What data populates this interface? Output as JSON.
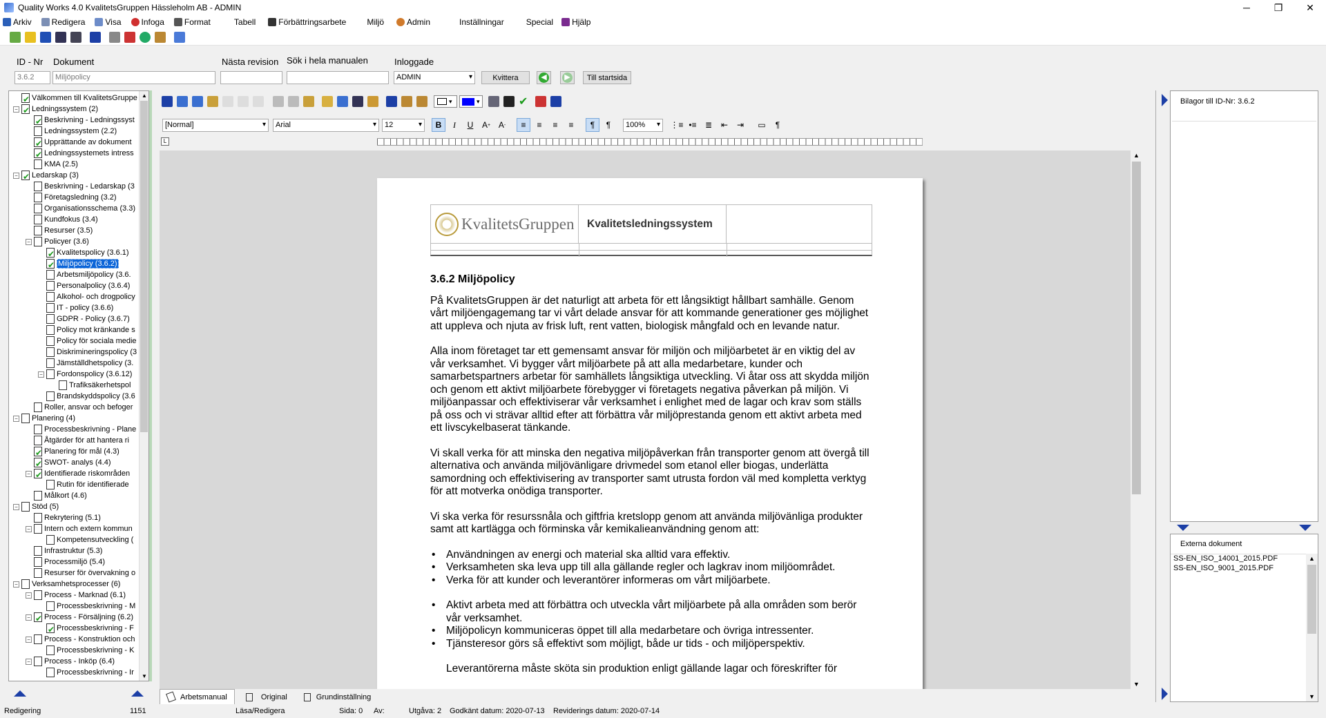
{
  "window": {
    "title": "Quality Works 4.0 KvalitetsGruppen Hässleholm AB - ADMIN"
  },
  "menu": [
    "Arkiv",
    "Redigera",
    "Visa",
    "Infoga",
    "Format",
    "Tabell",
    "Förbättringsarbete",
    "Miljö",
    "Admin",
    "Inställningar",
    "Special",
    "Hjälp"
  ],
  "header": {
    "id_label": "ID - Nr",
    "id_value": "3.6.2",
    "doc_label": "Dokument",
    "doc_value": "Miljöpolicy",
    "next_rev_label": "Nästa revision",
    "next_rev_value": "",
    "search_label": "Sök i hela manualen",
    "search_value": "",
    "logged_label": "Inloggade",
    "logged_value": "ADMIN",
    "kvittera": "Kvittera",
    "startpage": "Till startsida"
  },
  "tree": [
    {
      "label": "Välkommen till KvalitetsGruppe",
      "level": 1,
      "exp": "",
      "chk": true
    },
    {
      "label": "Ledningssystem (2)",
      "level": 1,
      "exp": "−",
      "chk": true
    },
    {
      "label": "Beskrivning - Ledningssyst",
      "level": 2,
      "exp": "",
      "chk": true
    },
    {
      "label": "Ledningssystem (2.2)",
      "level": 2,
      "exp": "",
      "chk": false
    },
    {
      "label": "Upprättande av dokument",
      "level": 2,
      "exp": "",
      "chk": true
    },
    {
      "label": "Ledningssystemets intress",
      "level": 2,
      "exp": "",
      "chk": true
    },
    {
      "label": "KMA (2.5)",
      "level": 2,
      "exp": "",
      "chk": false
    },
    {
      "label": "Ledarskap (3)",
      "level": 1,
      "exp": "−",
      "chk": true
    },
    {
      "label": "Beskrivning - Ledarskap (3",
      "level": 2,
      "exp": "",
      "chk": false
    },
    {
      "label": "Företagsledning (3.2)",
      "level": 2,
      "exp": "",
      "chk": false
    },
    {
      "label": "Organisationsschema (3.3)",
      "level": 2,
      "exp": "",
      "chk": false
    },
    {
      "label": "Kundfokus (3.4)",
      "level": 2,
      "exp": "",
      "chk": false
    },
    {
      "label": "Resurser (3.5)",
      "level": 2,
      "exp": "",
      "chk": false
    },
    {
      "label": "Policyer (3.6)",
      "level": 2,
      "exp": "−",
      "chk": false
    },
    {
      "label": "Kvalitetspolicy (3.6.1)",
      "level": 3,
      "exp": "",
      "chk": true
    },
    {
      "label": "Miljöpolicy (3.6.2)",
      "level": 3,
      "exp": "",
      "chk": true,
      "sel": true
    },
    {
      "label": "Arbetsmiljöpolicy (3.6.",
      "level": 3,
      "exp": "",
      "chk": false
    },
    {
      "label": "Personalpolicy (3.6.4)",
      "level": 3,
      "exp": "",
      "chk": false
    },
    {
      "label": "Alkohol- och drogpolicy",
      "level": 3,
      "exp": "",
      "chk": false
    },
    {
      "label": "IT - policy (3.6.6)",
      "level": 3,
      "exp": "",
      "chk": false
    },
    {
      "label": "GDPR - Policy (3.6.7)",
      "level": 3,
      "exp": "",
      "chk": false
    },
    {
      "label": "Policy mot kränkande s",
      "level": 3,
      "exp": "",
      "chk": false
    },
    {
      "label": "Policy för sociala medie",
      "level": 3,
      "exp": "",
      "chk": false
    },
    {
      "label": "Diskrimineringspolicy (3",
      "level": 3,
      "exp": "",
      "chk": false
    },
    {
      "label": "Jämställdhetspolicy (3.",
      "level": 3,
      "exp": "",
      "chk": false
    },
    {
      "label": "Fordonspolicy (3.6.12)",
      "level": 3,
      "exp": "−",
      "chk": false
    },
    {
      "label": "Trafiksäkerhetspol",
      "level": 4,
      "exp": "",
      "chk": false
    },
    {
      "label": "Brandskyddspolicy (3.6",
      "level": 3,
      "exp": "",
      "chk": false
    },
    {
      "label": "Roller, ansvar och befoger",
      "level": 2,
      "exp": "",
      "chk": false
    },
    {
      "label": "Planering (4)",
      "level": 1,
      "exp": "−",
      "chk": false
    },
    {
      "label": "Processbeskrivning - Plane",
      "level": 2,
      "exp": "",
      "chk": false
    },
    {
      "label": "Åtgärder för att hantera ri",
      "level": 2,
      "exp": "",
      "chk": false
    },
    {
      "label": "Planering för mål (4.3)",
      "level": 2,
      "exp": "",
      "chk": true
    },
    {
      "label": "SWOT- analys (4.4)",
      "level": 2,
      "exp": "",
      "chk": true
    },
    {
      "label": "Identifierade riskområden",
      "level": 2,
      "exp": "−",
      "chk": true
    },
    {
      "label": "Rutin för identifierade",
      "level": 3,
      "exp": "",
      "chk": false
    },
    {
      "label": "Målkort (4.6)",
      "level": 2,
      "exp": "",
      "chk": false
    },
    {
      "label": "Stöd (5)",
      "level": 1,
      "exp": "−",
      "chk": false
    },
    {
      "label": "Rekrytering (5.1)",
      "level": 2,
      "exp": "",
      "chk": false
    },
    {
      "label": "Intern och extern kommun",
      "level": 2,
      "exp": "−",
      "chk": false
    },
    {
      "label": "Kompetensutveckling (",
      "level": 3,
      "exp": "",
      "chk": false
    },
    {
      "label": "Infrastruktur (5.3)",
      "level": 2,
      "exp": "",
      "chk": false
    },
    {
      "label": "Processmiljö (5.4)",
      "level": 2,
      "exp": "",
      "chk": false
    },
    {
      "label": "Resurser för övervakning o",
      "level": 2,
      "exp": "",
      "chk": false
    },
    {
      "label": "Verksamhetsprocesser (6)",
      "level": 1,
      "exp": "−",
      "chk": false
    },
    {
      "label": "Process - Marknad (6.1)",
      "level": 2,
      "exp": "−",
      "chk": false
    },
    {
      "label": "Processbeskrivning - M",
      "level": 3,
      "exp": "",
      "chk": false
    },
    {
      "label": "Process - Försäljning (6.2)",
      "level": 2,
      "exp": "−",
      "chk": true
    },
    {
      "label": "Processbeskrivning - F",
      "level": 3,
      "exp": "",
      "chk": true
    },
    {
      "label": "Process - Konstruktion och",
      "level": 2,
      "exp": "−",
      "chk": false
    },
    {
      "label": "Processbeskrivning - K",
      "level": 3,
      "exp": "",
      "chk": false
    },
    {
      "label": "Process - Inköp (6.4)",
      "level": 2,
      "exp": "−",
      "chk": false
    },
    {
      "label": "Processbeskrivning - Ir",
      "level": 3,
      "exp": "",
      "chk": false
    }
  ],
  "format": {
    "style": "[Normal]",
    "font": "Arial",
    "size": "12",
    "zoom": "100%"
  },
  "doc": {
    "logo_text": "KvalitetsGruppen",
    "header_title": "Kvalitetsledningssystem",
    "heading": "3.6.2 Miljöpolicy",
    "p1": "På KvalitetsGruppen är det naturligt att arbeta för ett långsiktigt hållbart samhälle. Genom vårt miljöengagemang tar vi vårt delade ansvar för att kommande generationer ges möjlighet att uppleva och njuta av frisk luft, rent vatten, biologisk mångfald och en levande natur.",
    "p2": "Alla inom företaget tar ett gemensamt ansvar för miljön och miljöarbetet är en viktig del av vår verksamhet. Vi bygger vårt miljöarbete på att alla medarbetare, kunder och samarbetspartners arbetar för samhällets långsiktiga utveckling. Vi åtar oss att skydda miljön och genom ett aktivt miljöarbete förebygger vi företagets negativa påverkan på miljön. Vi miljöanpassar och effektiviserar vår verksamhet i enlighet med de lagar och krav som ställs på oss och vi strävar alltid efter att förbättra vår miljöprestanda genom ett aktivt arbeta med ett livscykelbaserat tänkande.",
    "p3": "Vi skall verka för att minska den negativa miljöpåverkan från transporter genom att övergå till alternativa och använda miljövänligare drivmedel som etanol eller biogas, underlätta samordning och effektivisering av transporter samt utrusta fordon väl med kompletta verktyg för att motverka onödiga transporter.",
    "p4": "Vi ska verka för resurssnåla och giftfria kretslopp genom att använda miljövänliga produkter samt att kartlägga och förminska vår kemikalieanvändning genom att:",
    "bullets1": [
      "Användningen av energi och material ska alltid vara effektiv.",
      "Verksamheten ska leva upp till alla gällande regler och lagkrav inom miljöområdet.",
      "Verka för att kunder och leverantörer informeras om vårt miljöarbete."
    ],
    "bullets2": [
      "Aktivt arbeta med att förbättra och utveckla vårt miljöarbete på alla områden som berör vår verksamhet.",
      "Miljöpolicyn kommuniceras öppet till alla medarbetare och övriga intressenter.",
      "Tjänsteresor görs så effektivt som möjligt, både ur tids - och miljöperspektiv."
    ],
    "cut_line": "Leverantörerna måste sköta sin produktion enligt gällande lagar och föreskrifter för"
  },
  "tabs": [
    "Arbetsmanual",
    "Original",
    "Grundinställning"
  ],
  "right": {
    "attachments_title": "Bilagor till ID-Nr: 3.6.2",
    "external_title": "Externa dokument",
    "external_docs": [
      "SS-EN_ISO_14001_2015.PDF",
      "SS-EN_ISO_9001_2015.PDF"
    ]
  },
  "status": {
    "mode": "Redigering",
    "count": "1151",
    "access": "Läsa/Redigera",
    "page": "Sida: 0",
    "av": "Av:",
    "edition": "Utgåva: 2",
    "approved": "Godkänt datum: 2020-07-13",
    "revision": "Reviderings datum: 2020-07-14"
  }
}
